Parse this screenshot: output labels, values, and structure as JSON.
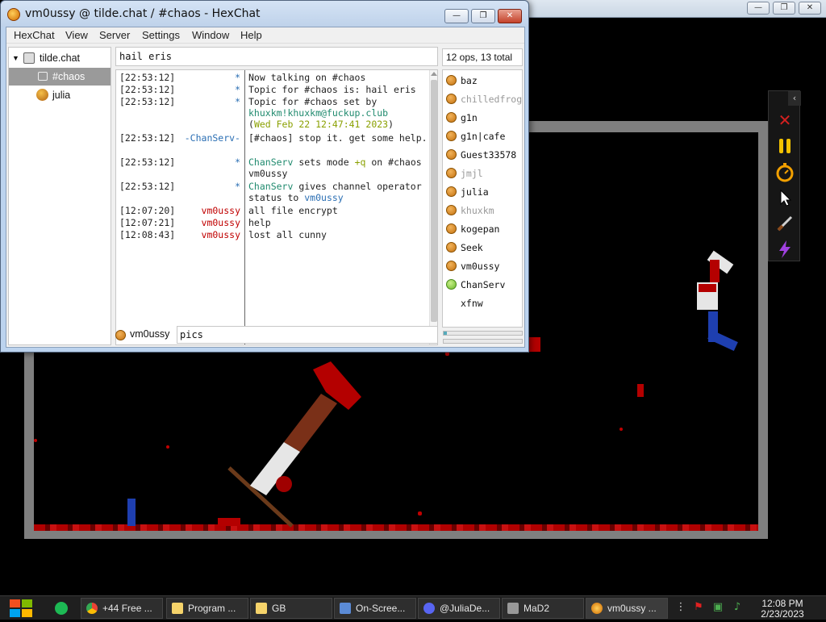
{
  "hexchat": {
    "title": "vm0ussy @ tilde.chat / #chaos - HexChat",
    "menu": [
      "HexChat",
      "View",
      "Server",
      "Settings",
      "Window",
      "Help"
    ],
    "tree": {
      "server": "tilde.chat",
      "channel": "#chaos",
      "query": "julia"
    },
    "topic": "hail eris",
    "user_count": "12 ops, 13 total",
    "chat": [
      {
        "time": "[22:53:12]",
        "nick": "*",
        "text": "Now talking on #chaos"
      },
      {
        "time": "[22:53:12]",
        "nick": "*",
        "text": "Topic for #chaos is: hail eris"
      },
      {
        "time": "[22:53:12]",
        "nick": "*",
        "text_a": "Topic for #chaos set by",
        "link": "khuxkm!khuxkm@fuckup.club",
        "paren_open": "(",
        "date": "Wed Feb 22 12:47:41 2023",
        "paren_close": ")"
      },
      {
        "time": "[22:53:12]",
        "nick": "-ChanServ-",
        "text": "[#chaos] stop it. get some help."
      },
      {
        "time": "[22:53:12]",
        "nick": "*",
        "who": "ChanServ",
        "text_a": "sets mode",
        "mode": "+q",
        "text_b": "on #chaos vm0ussy"
      },
      {
        "time": "[22:53:12]",
        "nick": "*",
        "who": "ChanServ",
        "text_a": "gives channel operator status to",
        "target": "vm0ussy"
      },
      {
        "time": "[12:07:20]",
        "nick": "vm0ussy",
        "text": "all file encrypt"
      },
      {
        "time": "[12:07:21]",
        "nick": "vm0ussy",
        "text": "help"
      },
      {
        "time": "[12:08:43]",
        "nick": "vm0ussy",
        "text": "lost all cunny"
      }
    ],
    "users": [
      {
        "name": "baz",
        "away": false,
        "op": false
      },
      {
        "name": "chilledfrog",
        "away": true,
        "op": false
      },
      {
        "name": "g1n",
        "away": false,
        "op": false
      },
      {
        "name": "g1n|cafe",
        "away": false,
        "op": false
      },
      {
        "name": "Guest33578",
        "away": false,
        "op": false
      },
      {
        "name": "jmjl",
        "away": true,
        "op": false
      },
      {
        "name": "julia",
        "away": false,
        "op": false
      },
      {
        "name": "khuxkm",
        "away": true,
        "op": false
      },
      {
        "name": "kogepan",
        "away": false,
        "op": false
      },
      {
        "name": "Seek",
        "away": false,
        "op": false
      },
      {
        "name": "vm0ussy",
        "away": false,
        "op": false
      },
      {
        "name": "ChanServ",
        "away": false,
        "op": true
      },
      {
        "name": "xfnw",
        "away": false,
        "op": false,
        "none": true
      }
    ],
    "input_nick": "vm0ussy",
    "input_value": "pics"
  },
  "colors": {
    "nick_self": "#c00000",
    "nick_server": "#2a6eb3",
    "link": "#1f8a6e",
    "date": "#8aa000",
    "mode": "#8aa000",
    "target": "#2a6eb3",
    "who": "#1f8a6e"
  },
  "taskbar": {
    "tasks": [
      "+44 Free ...",
      "Program ...",
      "GB",
      "On-Scree...",
      "@JuliaDe...",
      "MaD2",
      "vm0ussy ..."
    ],
    "time": "12:08 PM",
    "date": "2/23/2023"
  }
}
